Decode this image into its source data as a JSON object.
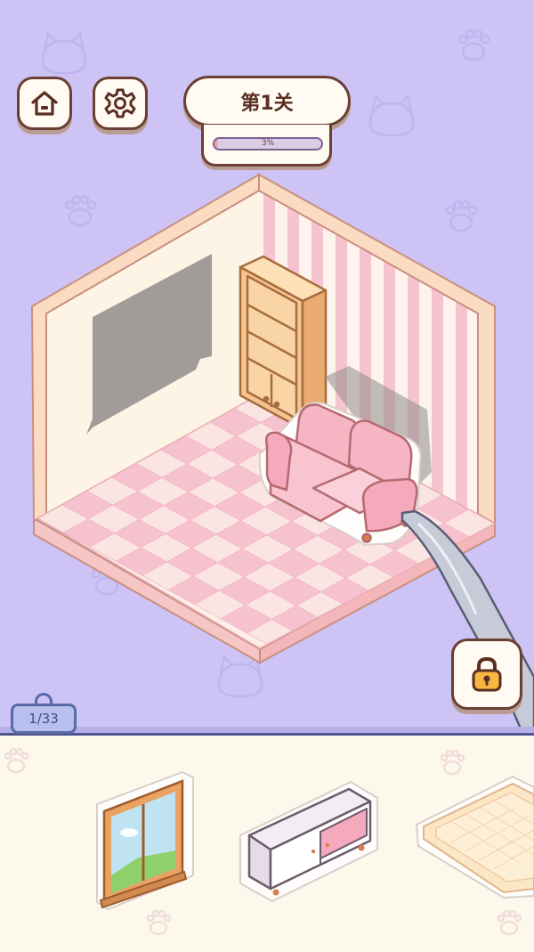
{
  "header": {
    "level_title": "第1关",
    "progress_percent": 3,
    "progress_label": "3%"
  },
  "buttons": {
    "home_icon": "home-icon",
    "settings_icon": "gear-icon",
    "lock_icon": "lock-icon"
  },
  "tray": {
    "counter_label": "1/33",
    "items": [
      {
        "name": "window",
        "icon": "window-icon"
      },
      {
        "name": "tv-cabinet",
        "icon": "cabinet-icon"
      },
      {
        "name": "floor-rug",
        "icon": "rug-icon"
      }
    ]
  },
  "room": {
    "placed_items": [
      "bookshelf",
      "sofa"
    ],
    "silhouette": "painting-slot",
    "held_item": "sofa"
  },
  "colors": {
    "background": "#cdc3f5",
    "outline": "#6b3f33",
    "wall_left": "#fdf3e4",
    "stripe_pink": "#f6c7d2",
    "floor_pink": "#f7c2cf",
    "sofa_pink": "#f4a9bd",
    "wood": "#f7c99a",
    "tray": "#fdf8ec"
  }
}
